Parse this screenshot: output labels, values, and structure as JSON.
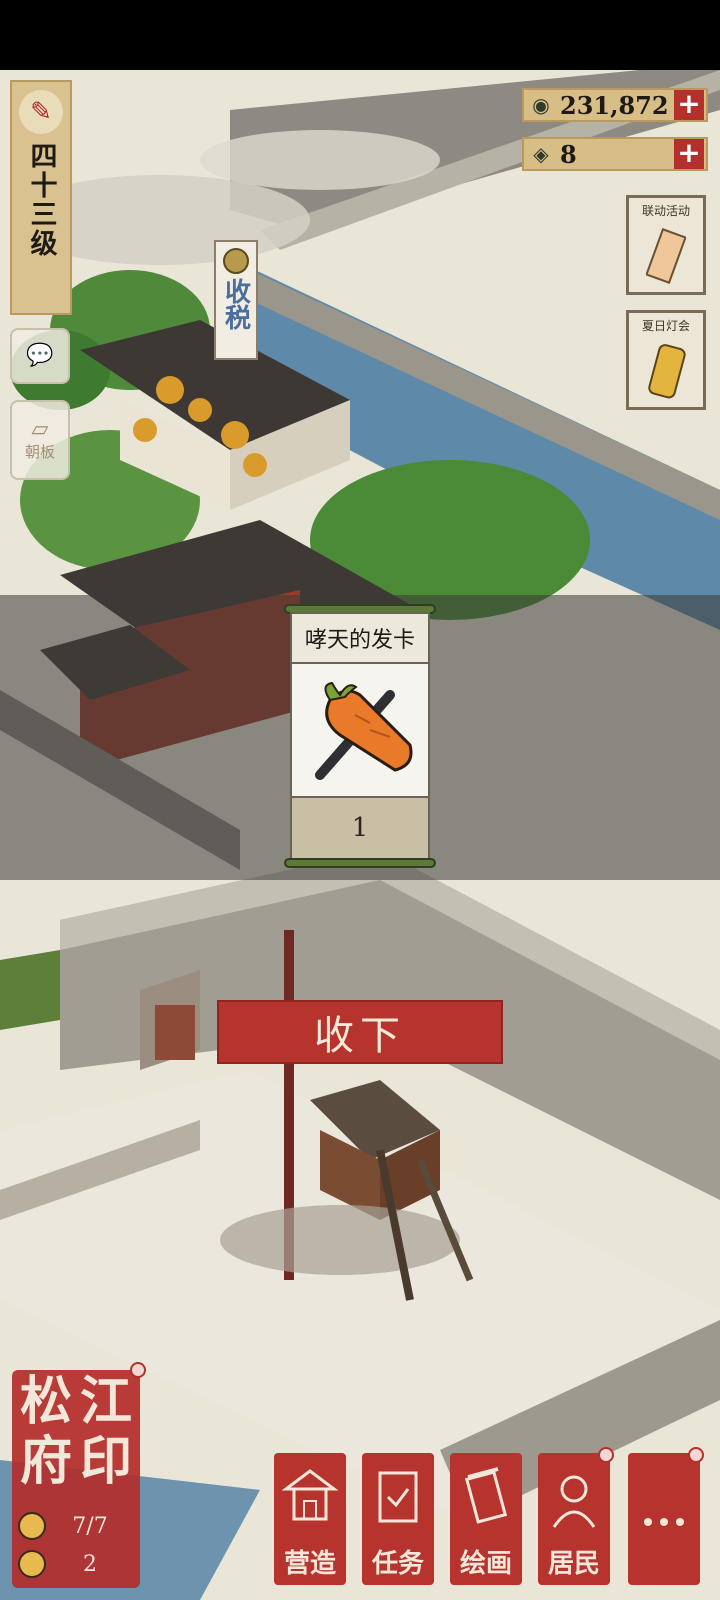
{
  "player": {
    "level_label": "四十三级"
  },
  "currency": [
    {
      "name": "copper-coins",
      "icon": "coin-icon",
      "value": "231,872"
    },
    {
      "name": "painting-scrolls",
      "icon": "scroll-icon",
      "value": "8"
    }
  ],
  "side_buttons": [
    {
      "label": ""
    },
    {
      "label": "朝板"
    }
  ],
  "events": [
    {
      "label": "联动活动"
    },
    {
      "label": "夏日灯会"
    }
  ],
  "tax_sign": {
    "text": "收税"
  },
  "reward": {
    "title": "哮天的发卡",
    "item_icon": "carrot-hairpin-icon",
    "count": "1"
  },
  "accept_button": {
    "label": "收下"
  },
  "city_seal": {
    "title": "松江府印",
    "chars": [
      "松",
      "江",
      "府",
      "印"
    ],
    "residents": "7/7",
    "stat2": "2"
  },
  "menu": [
    {
      "label": "营造",
      "icon": "building-icon"
    },
    {
      "label": "任务",
      "icon": "task-book-icon"
    },
    {
      "label": "绘画",
      "icon": "painting-scroll-icon"
    },
    {
      "label": "居民",
      "icon": "resident-icon"
    },
    {
      "label": "",
      "icon": "more-icon"
    }
  ],
  "colors": {
    "accent_red": "#b7332e",
    "paper": "#ece8dc",
    "gold": "#d7bd86"
  }
}
